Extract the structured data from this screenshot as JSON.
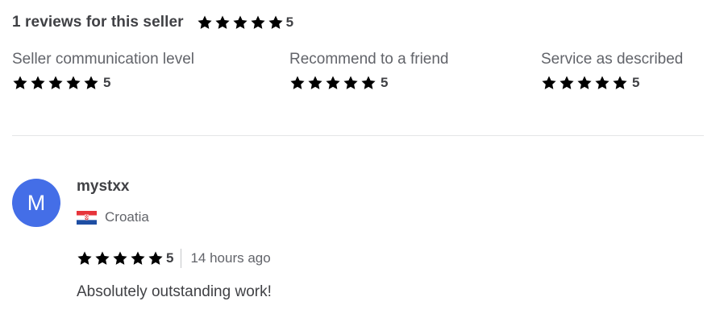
{
  "summary": {
    "title": "1 reviews for this seller",
    "rating": "5",
    "stars": 5
  },
  "breakdown": [
    {
      "label": "Seller communication level",
      "rating": "5",
      "stars": 5
    },
    {
      "label": "Recommend to a friend",
      "rating": "5",
      "stars": 5
    },
    {
      "label": "Service as described",
      "rating": "5",
      "stars": 5
    }
  ],
  "review": {
    "avatar_letter": "M",
    "username": "mystxx",
    "country": "Croatia",
    "flag": "croatia-flag-icon",
    "rating": "5",
    "stars": 5,
    "time": "14 hours ago",
    "text": "Absolutely outstanding work!"
  },
  "colors": {
    "text": "#404145",
    "muted": "#62646a",
    "avatar": "#446ee7",
    "divider": "#e4e5e7"
  }
}
